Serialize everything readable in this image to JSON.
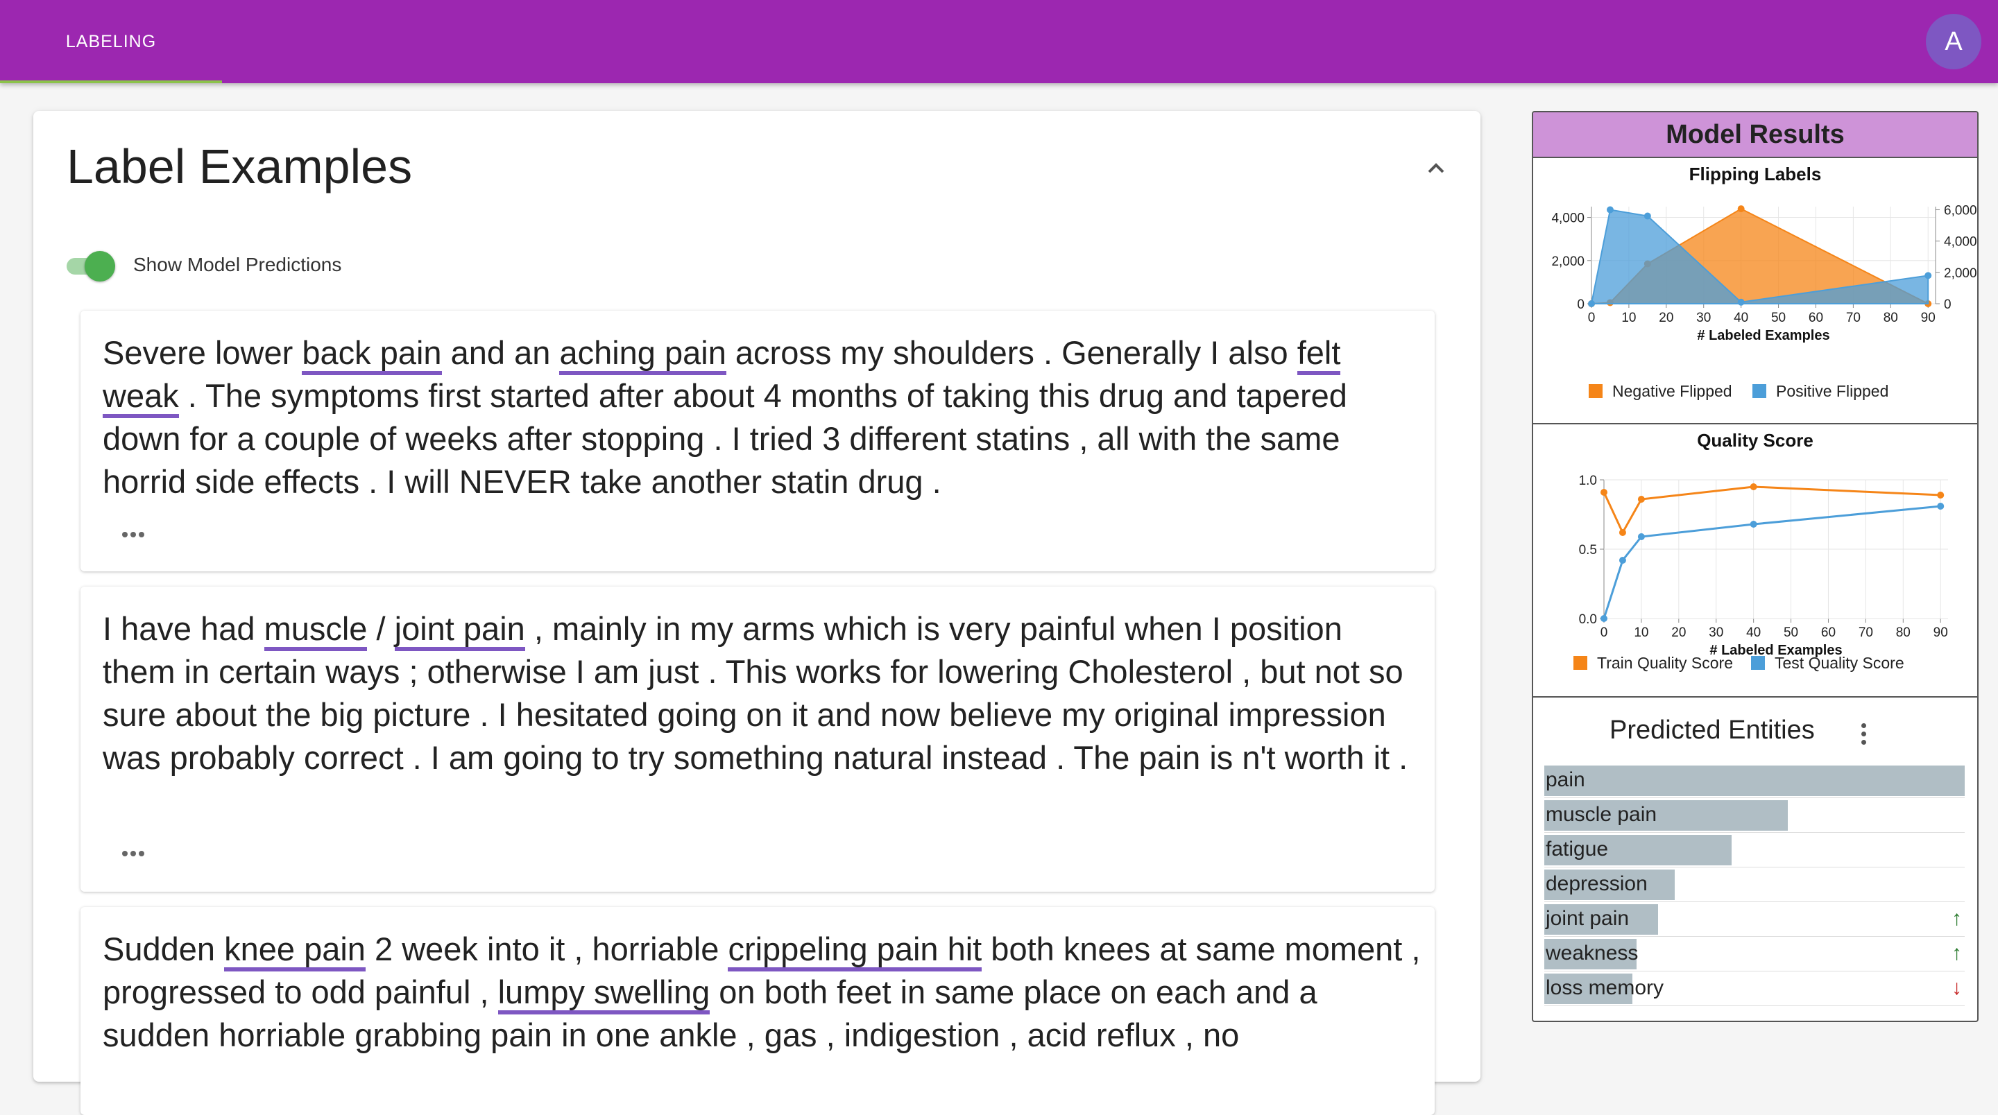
{
  "appbar": {
    "tab_label": "LABELING",
    "avatar_letter": "A",
    "color": "#9c27b0"
  },
  "main": {
    "title": "Label Examples",
    "toggle_label": "Show Model Predictions",
    "toggle_on": true,
    "examples": [
      {
        "segments": [
          {
            "t": "Severe lower "
          },
          {
            "t": "back pain",
            "e": true
          },
          {
            "t": " and an "
          },
          {
            "t": "aching pain",
            "e": true
          },
          {
            "t": " across my shoulders . Generally I also "
          },
          {
            "t": "felt weak",
            "e": true
          },
          {
            "t": " . The symptoms first started after about 4 months of taking this drug and tapered down for a couple of weeks after stopping . I tried 3 different statins , all with the same horrid side effects . I will NEVER take another statin drug ."
          }
        ]
      },
      {
        "segments": [
          {
            "t": "I have had "
          },
          {
            "t": "muscle",
            "e": true
          },
          {
            "t": " / "
          },
          {
            "t": "joint pain",
            "e": true
          },
          {
            "t": " , mainly in my arms which is very painful when I position them in certain ways ; otherwise I am just . This works for lowering Cholesterol , but not so sure about the big picture . I hesitated going on it and now believe my original impression was probably correct . I am going to try something natural instead . The pain is n't worth it ."
          }
        ]
      },
      {
        "segments": [
          {
            "t": "Sudden "
          },
          {
            "t": "knee pain",
            "e": true
          },
          {
            "t": " 2 week into it , horriable "
          },
          {
            "t": "crippeling pain hit",
            "e": true
          },
          {
            "t": " both knees at same moment , progressed to odd painful , "
          },
          {
            "t": "lumpy swelling",
            "e": true
          },
          {
            "t": " on both feet in same place on each and a sudden horriable grabbing pain in one ankle , gas , indigestion , acid reflux , no"
          }
        ]
      }
    ]
  },
  "panel": {
    "title": "Model Results",
    "flipping_title": "Flipping Labels",
    "quality_title": "Quality Score",
    "predicted_title": "Predicted Entities",
    "entities": [
      {
        "label": "pain",
        "fraction": 1.0,
        "arrow": ""
      },
      {
        "label": "muscle pain",
        "fraction": 0.58,
        "arrow": ""
      },
      {
        "label": "fatigue",
        "fraction": 0.445,
        "arrow": ""
      },
      {
        "label": "depression",
        "fraction": 0.31,
        "arrow": ""
      },
      {
        "label": "joint pain",
        "fraction": 0.27,
        "arrow": "↑",
        "arrow_color": "#2e7d32"
      },
      {
        "label": "weakness",
        "fraction": 0.22,
        "arrow": "↑",
        "arrow_color": "#2e7d32"
      },
      {
        "label": "loss memory",
        "fraction": 0.21,
        "arrow": "↓",
        "arrow_color": "#c62828"
      }
    ]
  },
  "chart_data": [
    {
      "type": "area",
      "title": "Flipping Labels",
      "xlabel": "# Labeled Examples",
      "x_ticks": [
        0,
        10,
        20,
        30,
        40,
        50,
        60,
        70,
        80,
        90
      ],
      "xlim": [
        0,
        92
      ],
      "left_axis": {
        "ticks": [
          "0",
          "2,000",
          "4,000"
        ],
        "ylim": [
          0,
          4500
        ]
      },
      "right_axis": {
        "ticks": [
          "0",
          "2,000",
          "4,000",
          "6,000"
        ],
        "ylim": [
          0,
          6200
        ]
      },
      "series": [
        {
          "name": "Negative Flipped",
          "color": "#f58518",
          "axis": "left",
          "x": [
            0,
            5,
            15,
            40,
            90
          ],
          "y": [
            0,
            50,
            1850,
            4400,
            0
          ]
        },
        {
          "name": "Positive Flipped",
          "color": "#4c9ed9",
          "axis": "right",
          "x": [
            0,
            5,
            15,
            40,
            90
          ],
          "y": [
            0,
            6000,
            5600,
            100,
            1800
          ]
        }
      ],
      "legend": [
        "Negative Flipped",
        "Positive Flipped"
      ]
    },
    {
      "type": "line",
      "title": "Quality Score",
      "xlabel": "# Labeled Examples",
      "x_ticks": [
        0,
        10,
        20,
        30,
        40,
        50,
        60,
        70,
        80,
        90
      ],
      "xlim": [
        0,
        92
      ],
      "y_ticks": [
        "0.0",
        "0.5",
        "1.0"
      ],
      "ylim": [
        0,
        1.0
      ],
      "series": [
        {
          "name": "Train Quality Score",
          "color": "#f58518",
          "x": [
            0,
            5,
            10,
            40,
            90
          ],
          "y": [
            0.91,
            0.62,
            0.86,
            0.95,
            0.89
          ]
        },
        {
          "name": "Test Quality Score",
          "color": "#4c9ed9",
          "x": [
            0,
            5,
            10,
            40,
            90
          ],
          "y": [
            0.0,
            0.42,
            0.59,
            0.68,
            0.81
          ]
        }
      ],
      "legend": [
        "Train Quality Score",
        "Test Quality Score"
      ]
    }
  ]
}
